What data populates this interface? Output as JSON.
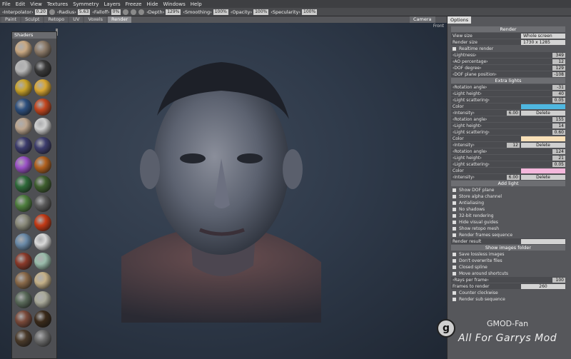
{
  "menu": [
    "File",
    "Edit",
    "View",
    "Textures",
    "Symmetry",
    "Layers",
    "Freeze",
    "Hide",
    "Windows",
    "Help"
  ],
  "toolbar": {
    "interpolator_label": "‹Interpolator›",
    "interpolator_val": "0.20",
    "radius_label": "‹Radius›",
    "radius_val": "5.63",
    "falloff_label": "‹Falloff›",
    "falloff_val": "0%",
    "depth_label": "‹Depth›",
    "depth_val": "129%",
    "smoothing_label": "‹Smoothing›",
    "smoothing_val": "100%",
    "opacity_label": "‹Opacity›",
    "opacity_val": "100%",
    "specularity_label": "‹Specularity›",
    "specularity_val": "100%",
    "camera": "Camera"
  },
  "tabs": [
    "Paint",
    "Sculpt",
    "Retopo",
    "UV",
    "Voxels",
    "Render"
  ],
  "viewport": {
    "label": "Front"
  },
  "shaders": {
    "title": "Shaders",
    "colors": [
      "#c8a882",
      "#8c7a68",
      "#b7b7b7",
      "#383838",
      "#c9a32a",
      "#d8a632",
      "#2d4f7d",
      "#c2461f",
      "#bca58e",
      "#cfcfcf",
      "#3b3b6b",
      "#3d3d6d",
      "#9a51c6",
      "#b0601e",
      "#2f6a3a",
      "#3f5f2f",
      "#4f7f3f",
      "#5a5a5a",
      "#8a8a7a",
      "#c33a16",
      "#6a8aa8",
      "#d9d9d9",
      "#8a3a2a",
      "#9abcab",
      "#8a6a4a",
      "#c4b088",
      "#5a6a5a",
      "#aaaa9a",
      "#7a4a3a",
      "#3a2a1a",
      "#4a3a2a",
      "#6a6a6a"
    ]
  },
  "options": {
    "tab": "Options",
    "render_header": "Render",
    "view_size_label": "View size",
    "view_size_val": "Whole screen",
    "render_size_label": "Render size",
    "render_size_val": "1730 x 1285",
    "realtime_render": "Realtime render",
    "lightness_label": "‹Lightness›",
    "lightness_val": "349",
    "ao_label": "‹AO percentage›",
    "ao_val": "12",
    "dof_degree_label": "‹DOF degree›",
    "dof_degree_val": "129",
    "dof_plane_label": "‹DOF plane position›",
    "dof_plane_val": "-108",
    "extra_lights": "Extra lights",
    "rotation_label": "‹Rotation angle›",
    "height_label": "‹Light height›",
    "scattering_label": "‹Light scattering›",
    "color_label": "Color",
    "intensity_label": "‹Intensity›",
    "delete_label": "Delete",
    "light1": {
      "rot": "-31",
      "height": "40",
      "scatter": "0.05",
      "color": "#4fb7e0",
      "intensity": "6.00"
    },
    "light2": {
      "rot": "155",
      "height": "14",
      "scatter": "0.60",
      "color": "#f8e0b8",
      "intensity": "12"
    },
    "light3": {
      "rot": "124",
      "height": "21",
      "scatter": "0.05",
      "color": "#f4b8dc",
      "intensity": "6.00"
    },
    "add_light": "Add light",
    "show_dof": "Show DOF plane",
    "store_alpha": "Store alpha channel",
    "antialiasing": "Antialiasing",
    "no_shadows": "No shadows",
    "bit32": "32-bit rendering",
    "hide_guides": "Hide visual guides",
    "show_retopo": "Show retopo mesh",
    "render_frames": "Render frames sequence",
    "render_result_label": "Render result",
    "show_images": "Show images folder",
    "save_lossless": "Save lossless images",
    "dont_overwrite": "Don't overwrite files",
    "closed_spline": "Closed spline",
    "move_shortcuts": "Move around shortcuts",
    "rays_label": "‹Rays per frame›",
    "rays_val": "100",
    "frames_label": "Frames to render",
    "frames_val": "260",
    "counter_clockwise": "Counter clockwise",
    "render_sub": "Render sub sequence"
  },
  "watermark": {
    "logo": "g",
    "line1": "GMOD-Fan",
    "line2": "All For Garrys Mod"
  }
}
